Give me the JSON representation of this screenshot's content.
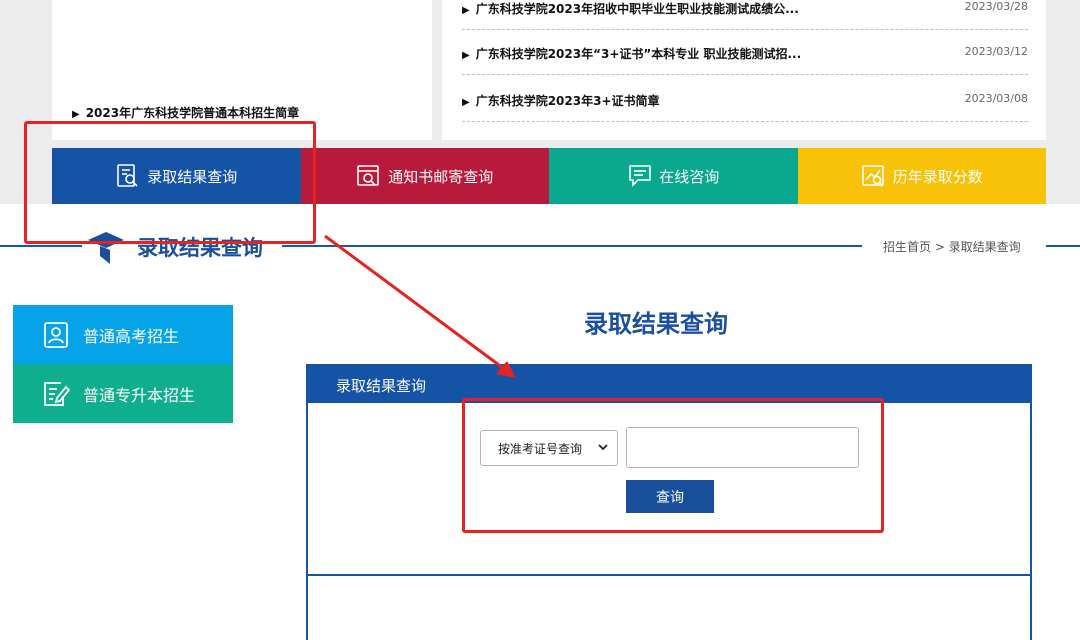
{
  "news": {
    "left_item": "2023年广东科技学院普通本科招生简章",
    "right_items": [
      {
        "title": "广东科技学院2023年招收中职毕业生职业技能测试成绩公...",
        "date": "2023/03/28"
      },
      {
        "title": "广东科技学院2023年“3+证书”本科专业 职业技能测试招...",
        "date": "2023/03/12"
      },
      {
        "title": "广东科技学院2023年3+证书简章",
        "date": "2023/03/08"
      }
    ]
  },
  "tabs": [
    {
      "label": "录取结果查询",
      "icon": "search-document-icon"
    },
    {
      "label": "通知书邮寄查询",
      "icon": "mail-search-icon"
    },
    {
      "label": "在线咨询",
      "icon": "chat-icon"
    },
    {
      "label": "历年录取分数",
      "icon": "score-history-icon"
    }
  ],
  "section": {
    "title": "录取结果查询",
    "breadcrumb": "招生首页 > 录取结果查询"
  },
  "sidebar": {
    "items": [
      {
        "label": "普通高考招生",
        "icon": "user-card-icon"
      },
      {
        "label": "普通专升本招生",
        "icon": "edit-document-icon"
      }
    ]
  },
  "main": {
    "title": "录取结果查询",
    "panel_header": "录取结果查询",
    "select_value": "按准考证号查询",
    "input_value": "",
    "button_label": "查询"
  },
  "colors": {
    "blue": "#1553a6",
    "red": "#b81a3b",
    "teal": "#0aa98f",
    "yellow": "#f7c208",
    "light_blue": "#06a3e8",
    "annotation_red": "#e52421"
  }
}
